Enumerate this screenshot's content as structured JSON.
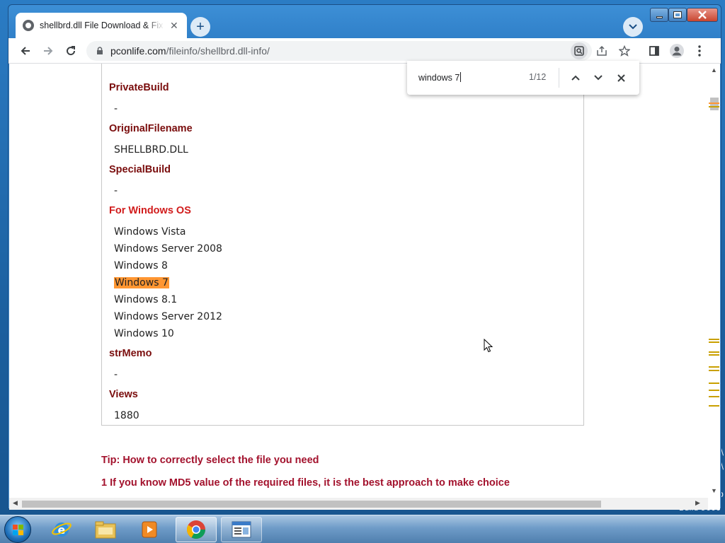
{
  "desktop": {
    "build_text": "Build 9600"
  },
  "browser": {
    "tab": {
      "title": "shellbrd.dll File Download & Fix I",
      "close": "✕"
    },
    "new_tab": "+",
    "url": {
      "domain": "pconlife.com",
      "path": "/fileinfo/shellbrd.dll-info/"
    }
  },
  "find_bar": {
    "query": "windows 7",
    "count": "1/12"
  },
  "page": {
    "fields": [
      {
        "label": "PrivateBuild",
        "value": "-"
      },
      {
        "label": "OriginalFilename",
        "value": "SHELLBRD.DLL"
      },
      {
        "label": "SpecialBuild",
        "value": "-"
      }
    ],
    "os_label": "For Windows OS",
    "os_list": [
      "Windows Vista",
      "Windows Server 2008",
      "Windows 8",
      "Windows 7",
      "Windows 8.1",
      "Windows Server 2012",
      "Windows 10"
    ],
    "fields2": [
      {
        "label": "strMemo",
        "value": "-"
      },
      {
        "label": "Views",
        "value": "1880"
      }
    ],
    "tip_title": "Tip: How to correctly select the file you need",
    "tip_1": "1 If you know MD5 value of the required files, it is the best approach to make choice"
  },
  "colors": {
    "label": "#7a0d0d",
    "os_label": "#d11c1c",
    "tip": "#a3122d",
    "highlight": "#ff9632"
  }
}
